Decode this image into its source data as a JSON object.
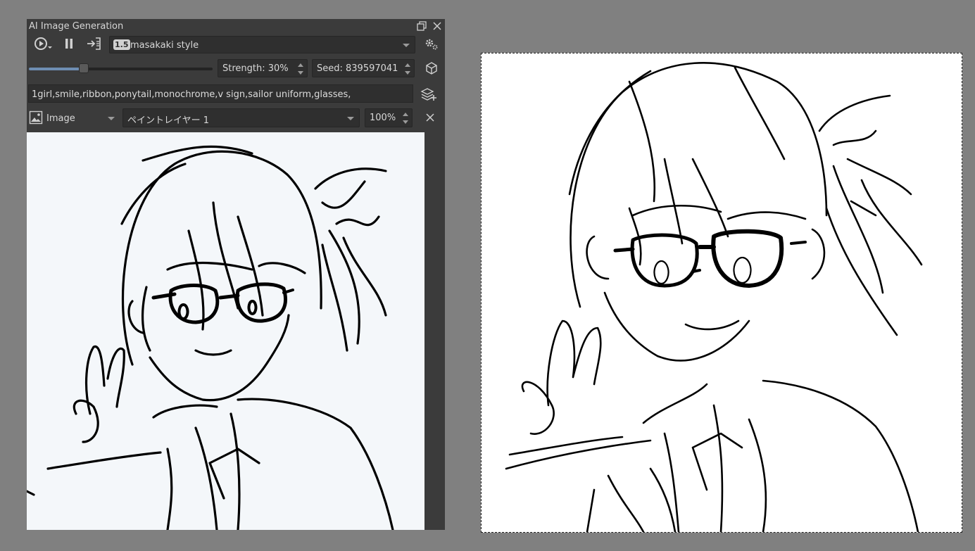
{
  "docker": {
    "title": "AI Image Generation",
    "style_badge": "1.5",
    "style_name": "masakaki style",
    "strength_label": "Strength: 30%",
    "strength_value": 0.3,
    "seed_label": "Seed: 839597041",
    "prompt": "1girl,smile,ribbon,ponytail,monochrome,v sign,sailor uniform,glasses,",
    "source_type": "Image",
    "layer_name": "ペイントレイヤー 1",
    "opacity": "100%"
  },
  "icons": {
    "float": "float-icon",
    "close": "close-icon",
    "generate": "play-dropdown-icon",
    "pause": "pause-icon",
    "apply": "apply-icon",
    "settings": "gear-icon",
    "random_seed": "dice-icon",
    "add_region": "layers-add-icon",
    "image": "image-icon",
    "remove": "x-icon"
  },
  "colors": {
    "docker_bg": "#3b3b3b",
    "canvas_bg": "#808080",
    "slider_fill": "#6e8eb3"
  }
}
